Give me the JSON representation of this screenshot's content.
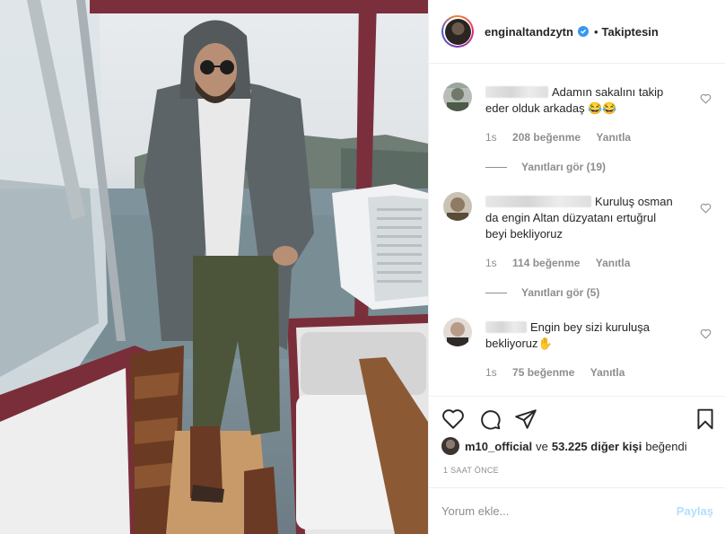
{
  "post": {
    "username": "enginaltandzytn",
    "follow_separator": "•",
    "follow_state": "Takiptesin"
  },
  "comments": [
    {
      "text": "Adamın sakalını takip eder olduk arkadaş 😂😂",
      "time": "1s",
      "likes": "208 beğenme",
      "reply_label": "Yanıtla",
      "view_replies": "Yanıtları gör (19)"
    },
    {
      "text": "Kuruluş osman da engin Altan düzyatanı ertuğrul beyi bekliyoruz",
      "time": "1s",
      "likes": "114 beğenme",
      "reply_label": "Yanıtla",
      "view_replies": "Yanıtları gör (5)"
    },
    {
      "text": "Engin bey sizi kuruluşa bekliyoruz✋",
      "time": "1s",
      "likes": "75 beğenme",
      "reply_label": "Yanıtla"
    }
  ],
  "likes_summary": {
    "first_liker": "m10_official",
    "connector": "ve",
    "others": "53.225 diğer kişi",
    "suffix": "beğendi"
  },
  "timestamp": "1 SAAT ÖNCE",
  "comment_box": {
    "placeholder": "Yorum ekle...",
    "post_label": "Paylaş"
  },
  "colors": {
    "verified": "#3897f0",
    "post_disabled": "#b2dffc",
    "muted": "#8e8e8e"
  }
}
